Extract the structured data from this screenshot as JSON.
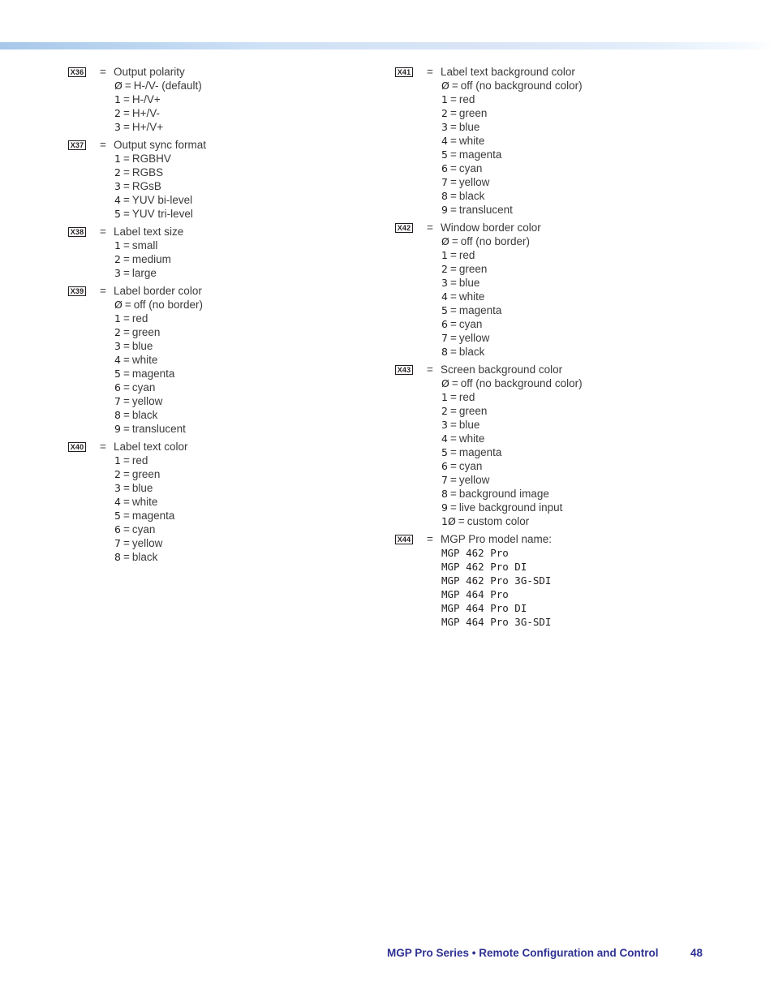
{
  "left_column": [
    {
      "tag": "X36",
      "desc": "Output polarity",
      "options": [
        {
          "num": "Ø",
          "label": "H-/V- (default)"
        },
        {
          "num": "1",
          "label": "H-/V+"
        },
        {
          "num": "2",
          "label": "H+/V-"
        },
        {
          "num": "3",
          "label": "H+/V+"
        }
      ]
    },
    {
      "tag": "X37",
      "desc": "Output sync format",
      "options": [
        {
          "num": "1",
          "label": "RGBHV"
        },
        {
          "num": "2",
          "label": "RGBS"
        },
        {
          "num": "3",
          "label": "RGsB"
        },
        {
          "num": "4",
          "label": "YUV bi-level"
        },
        {
          "num": "5",
          "label": "YUV tri-level"
        }
      ]
    },
    {
      "tag": "X38",
      "desc": "Label text size",
      "options": [
        {
          "num": "1",
          "label": "small"
        },
        {
          "num": "2",
          "label": "medium"
        },
        {
          "num": "3",
          "label": "large"
        }
      ]
    },
    {
      "tag": "X39",
      "desc": "Label border color",
      "options": [
        {
          "num": "Ø",
          "label": "off (no border)"
        },
        {
          "num": "1",
          "label": "red"
        },
        {
          "num": "2",
          "label": "green"
        },
        {
          "num": "3",
          "label": "blue"
        },
        {
          "num": "4",
          "label": "white"
        },
        {
          "num": "5",
          "label": "magenta"
        },
        {
          "num": "6",
          "label": "cyan"
        },
        {
          "num": "7",
          "label": "yellow"
        },
        {
          "num": "8",
          "label": "black"
        },
        {
          "num": "9",
          "label": "translucent"
        }
      ]
    },
    {
      "tag": "X40",
      "desc": "Label text color",
      "options": [
        {
          "num": "1",
          "label": "red"
        },
        {
          "num": "2",
          "label": "green"
        },
        {
          "num": "3",
          "label": "blue"
        },
        {
          "num": "4",
          "label": "white"
        },
        {
          "num": "5",
          "label": "magenta"
        },
        {
          "num": "6",
          "label": "cyan"
        },
        {
          "num": "7",
          "label": "yellow"
        },
        {
          "num": "8",
          "label": "black"
        }
      ]
    }
  ],
  "right_column": [
    {
      "tag": "X41",
      "desc": "Label text background color",
      "options": [
        {
          "num": "Ø",
          "label": "off (no background color)"
        },
        {
          "num": "1",
          "label": "red"
        },
        {
          "num": "2",
          "label": "green"
        },
        {
          "num": "3",
          "label": "blue"
        },
        {
          "num": "4",
          "label": "white"
        },
        {
          "num": "5",
          "label": "magenta"
        },
        {
          "num": "6",
          "label": "cyan"
        },
        {
          "num": "7",
          "label": "yellow"
        },
        {
          "num": "8",
          "label": "black"
        },
        {
          "num": "9",
          "label": "translucent"
        }
      ]
    },
    {
      "tag": "X42",
      "desc": "Window border color",
      "options": [
        {
          "num": "Ø",
          "label": "off (no border)"
        },
        {
          "num": "1",
          "label": "red"
        },
        {
          "num": "2",
          "label": "green"
        },
        {
          "num": "3",
          "label": "blue"
        },
        {
          "num": "4",
          "label": "white"
        },
        {
          "num": "5",
          "label": "magenta"
        },
        {
          "num": "6",
          "label": "cyan"
        },
        {
          "num": "7",
          "label": "yellow"
        },
        {
          "num": "8",
          "label": "black"
        }
      ]
    },
    {
      "tag": "X43",
      "desc": "Screen background color",
      "options": [
        {
          "num": "Ø",
          "label": "off (no background color)"
        },
        {
          "num": "1",
          "label": "red"
        },
        {
          "num": "2",
          "label": "green"
        },
        {
          "num": "3",
          "label": "blue"
        },
        {
          "num": "4",
          "label": "white"
        },
        {
          "num": "5",
          "label": "magenta"
        },
        {
          "num": "6",
          "label": "cyan"
        },
        {
          "num": "7",
          "label": "yellow"
        },
        {
          "num": "8",
          "label": "background image"
        },
        {
          "num": "9",
          "label": "live background input"
        },
        {
          "num": "1Ø",
          "label": "custom color"
        }
      ]
    },
    {
      "tag": "X44",
      "desc": "MGP Pro model name:",
      "models": [
        "MGP 462 Pro",
        "MGP 462 Pro DI",
        "MGP 462 Pro 3G-SDI",
        "MGP 464 Pro",
        "MGP 464 Pro DI",
        "MGP 464 Pro 3G-SDI"
      ]
    }
  ],
  "equals_sign": "=",
  "footer": {
    "title": "MGP Pro Series • Remote Configuration and Control",
    "page_number": "48",
    "color": "#2e3192"
  }
}
